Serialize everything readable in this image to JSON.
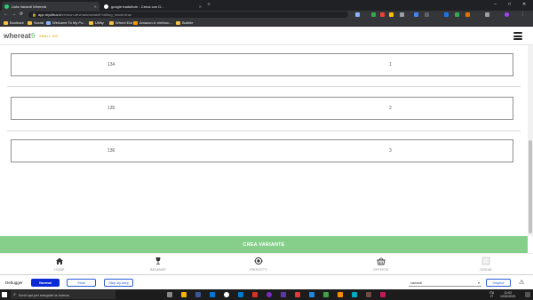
{
  "browser": {
    "tabs": [
      {
        "title": "Lista Varianti Whereat",
        "fav_color": "#2ecc71"
      },
      {
        "title": "google traduttore - Cerca con G...",
        "fav_color": "#ffffff"
      }
    ],
    "new_tab_symbol": "+",
    "window_controls": [
      "–",
      "□",
      "✕"
    ],
    "url_host": "app.mycibus.it",
    "url_path": "/version-devmark/varianti?debug_mode=true",
    "bookmarks": [
      "Booleani",
      "Social",
      "Welcome To My Po...",
      "Utility",
      "Where:Eat",
      "Amazon.it: elettron...",
      "Bubble"
    ]
  },
  "app": {
    "logo_text": "whereat",
    "logo_pin": "9",
    "logo_tagline": "SMALL INC",
    "menu_icon": "hamburger-icon"
  },
  "variants": [
    {
      "code": "134",
      "number": "1"
    },
    {
      "code": "135",
      "number": "2"
    },
    {
      "code": "136",
      "number": "3"
    }
  ],
  "create_button": "CREA VARIANTE",
  "bottom_nav": [
    {
      "label": "HOME",
      "icon": "home-icon"
    },
    {
      "label": "BEVANDE",
      "icon": "glass-icon"
    },
    {
      "label": "PRODOTTI",
      "icon": "product-icon"
    },
    {
      "label": "OFFERTE",
      "icon": "basket-icon"
    },
    {
      "label": "ORDINI",
      "icon": "orders-icon"
    }
  ],
  "debugger": {
    "label": "Debugger",
    "modes": [
      "Normal",
      "Slow",
      "Step-by-step"
    ],
    "selected_mode": "Normal",
    "element_select": "varianti",
    "inspect_label": "Inspect",
    "warning_icon": "warning-icon"
  },
  "taskbar": {
    "search_placeholder": "Scrivi qui per eseguire la ricerca",
    "language": "ITA",
    "region": "IT",
    "time": "11:02",
    "date": "12/02/2021"
  },
  "colors": {
    "accent_green": "#86cf8a",
    "debugger_blue": "#0a2ad6",
    "tagline_yellow": "#e2b93b"
  }
}
